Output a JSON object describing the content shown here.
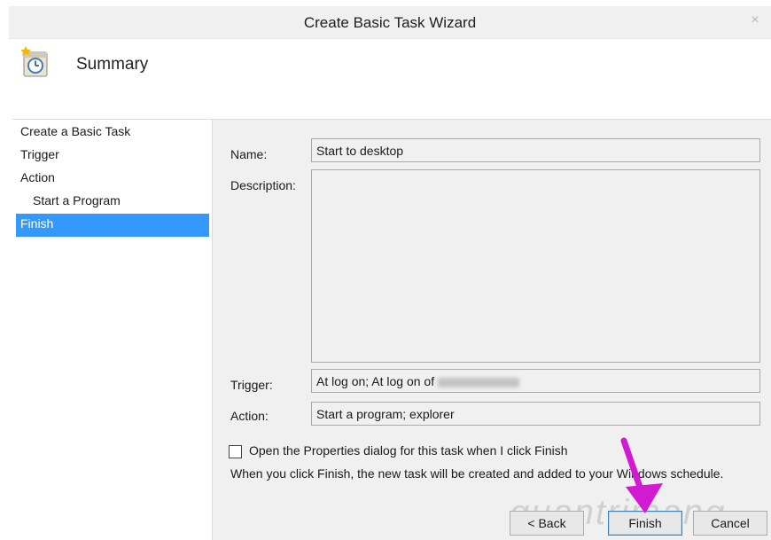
{
  "window": {
    "title": "Create Basic Task Wizard",
    "close_glyph": "×"
  },
  "header": {
    "title": "Summary",
    "icon": "task-scheduler-clock-icon"
  },
  "steps": [
    {
      "label": "Create a Basic Task",
      "active": false,
      "sub": false
    },
    {
      "label": "Trigger",
      "active": false,
      "sub": false
    },
    {
      "label": "Action",
      "active": false,
      "sub": false
    },
    {
      "label": "Start a Program",
      "active": false,
      "sub": true
    },
    {
      "label": "Finish",
      "active": true,
      "sub": false
    }
  ],
  "form": {
    "name_label": "Name:",
    "name_value": "Start to desktop",
    "description_label": "Description:",
    "description_value": "",
    "trigger_label": "Trigger:",
    "trigger_value": "At log on; At log on of",
    "action_label": "Action:",
    "action_value": "Start a program; explorer"
  },
  "checkbox": {
    "label": "Open the Properties dialog for this task when I click Finish",
    "checked": false
  },
  "info_text": "When you click Finish, the new task will be created and added to your Windows schedule.",
  "buttons": {
    "back": "< Back",
    "finish": "Finish",
    "cancel": "Cancel"
  },
  "watermark": "quantrimang",
  "colors": {
    "selection": "#3399ff",
    "annotation_arrow": "#d21ad2"
  }
}
